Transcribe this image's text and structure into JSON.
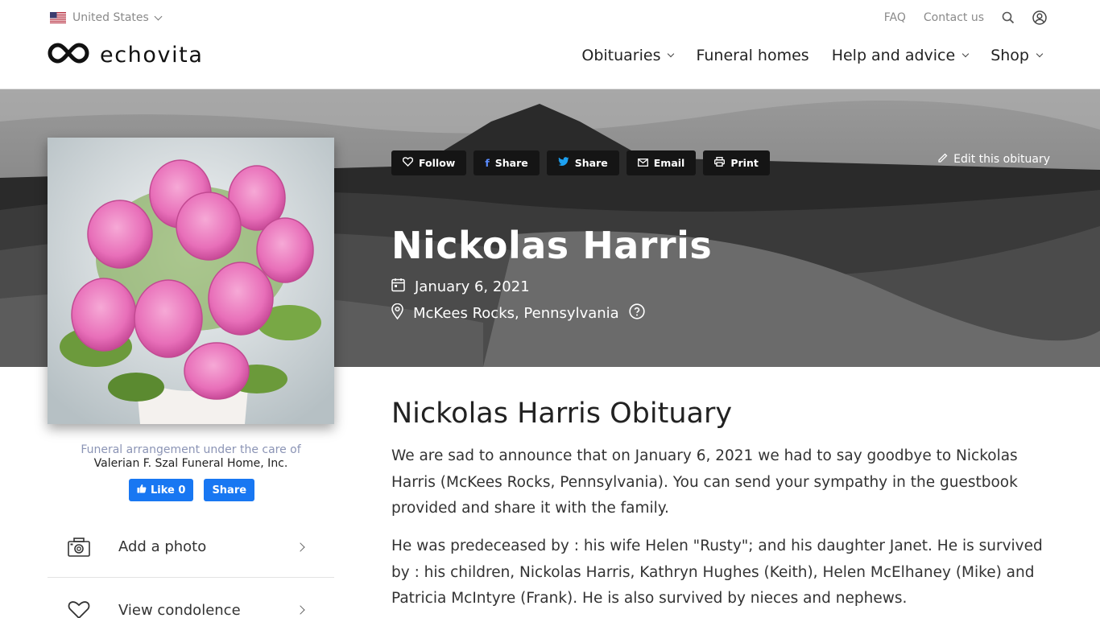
{
  "header": {
    "country": "United States",
    "top_links": {
      "faq": "FAQ",
      "contact": "Contact us"
    },
    "logo_text": "echovita",
    "nav": [
      "Obituaries",
      "Funeral homes",
      "Help and advice",
      "Shop"
    ]
  },
  "hero": {
    "actions": {
      "follow": "Follow",
      "facebook_share": "Share",
      "twitter_share": "Share",
      "email": "Email",
      "print": "Print"
    },
    "edit_label": "Edit this obituary",
    "name": "Nickolas Harris",
    "date": "January 6, 2021",
    "location": "McKees Rocks, Pennsylvania"
  },
  "sidebar": {
    "care_label": "Funeral arrangement under the care of",
    "funeral_home": "Valerian F. Szal Funeral Home, Inc.",
    "fb_like": "Like 0",
    "fb_share": "Share",
    "items": [
      {
        "label": "Add a photo",
        "icon": "camera-icon"
      },
      {
        "label": "View condolence",
        "icon": "heart-icon"
      }
    ]
  },
  "main": {
    "title": "Nickolas Harris Obituary",
    "paragraphs": [
      "We are sad to announce that on January 6, 2021 we had to say goodbye to Nickolas Harris (McKees Rocks, Pennsylvania). You can send your sympathy in the guestbook provided and share it with the family.",
      "He was predeceased by : his wife Helen \"Rusty\"; and his daughter Janet. He is survived by : his children, Nickolas Harris, Kathryn Hughes (Keith), Helen McElhaney (Mike) and Patricia McIntyre (Frank). He is also survived by nieces and nephews."
    ]
  },
  "colors": {
    "facebook": "#1877f2",
    "action_button": "#151515",
    "care_label": "#8b94b5"
  }
}
